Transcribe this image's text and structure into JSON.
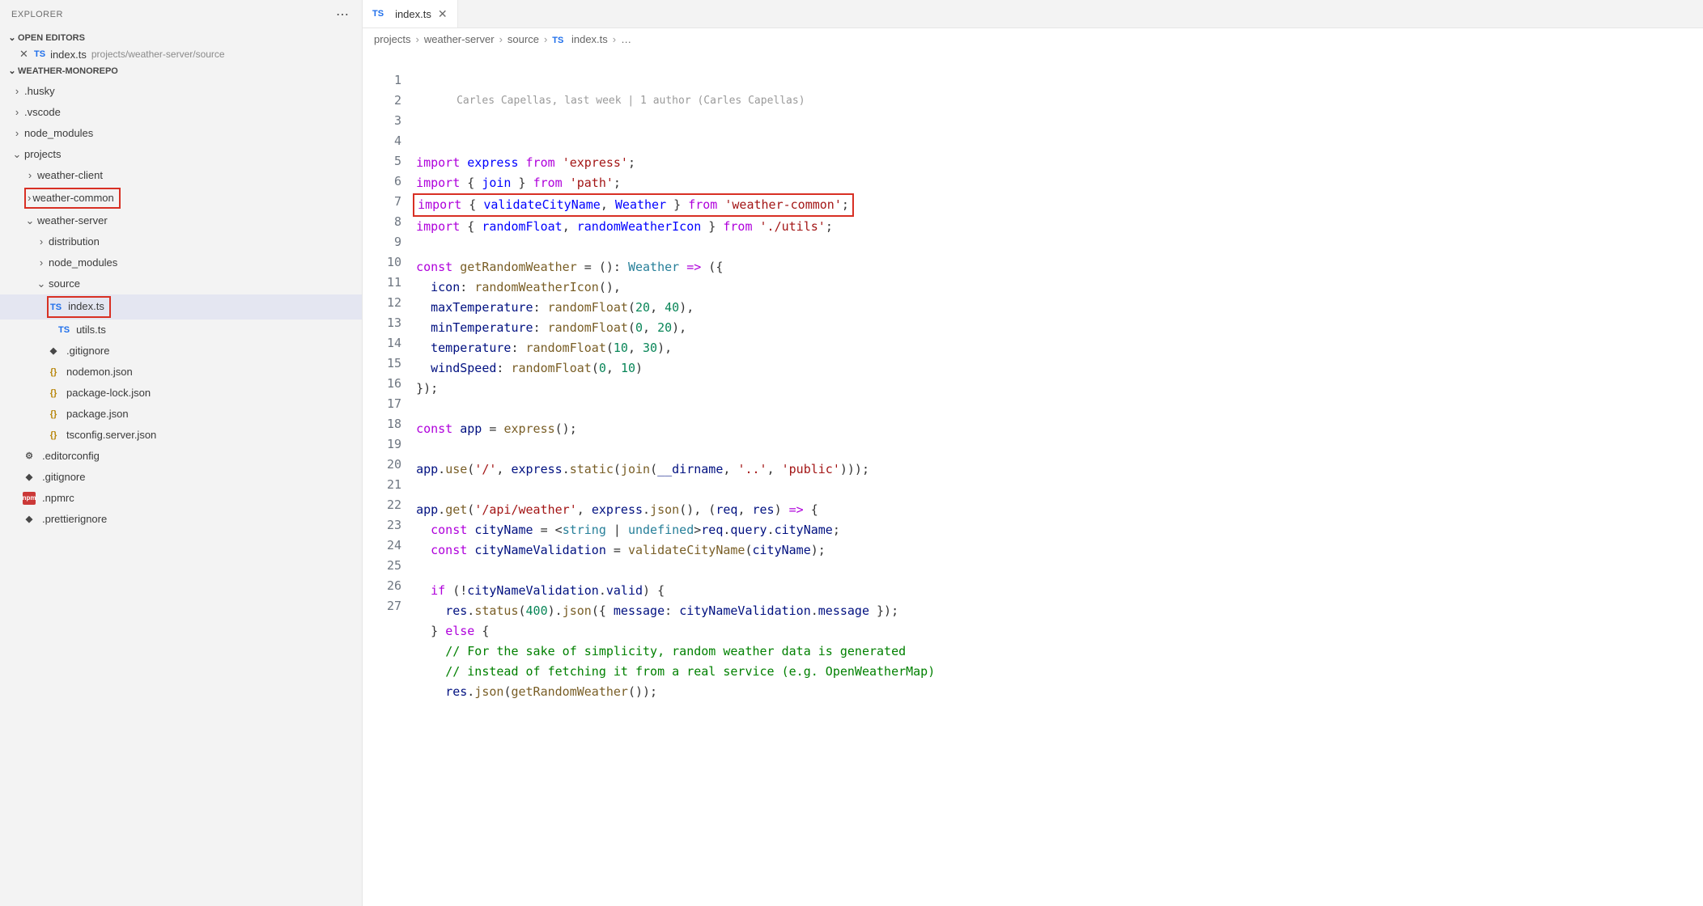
{
  "sidebar": {
    "title": "EXPLORER",
    "openEditors": {
      "label": "OPEN EDITORS",
      "items": [
        {
          "type": "TS",
          "name": "index.ts",
          "path": "projects/weather-server/source"
        }
      ]
    },
    "workspace": {
      "label": "WEATHER-MONOREPO",
      "tree": [
        {
          "label": ".husky",
          "kind": "folder",
          "expanded": false,
          "depth": 0
        },
        {
          "label": ".vscode",
          "kind": "folder",
          "expanded": false,
          "depth": 0
        },
        {
          "label": "node_modules",
          "kind": "folder",
          "expanded": false,
          "depth": 0
        },
        {
          "label": "projects",
          "kind": "folder",
          "expanded": true,
          "depth": 0
        },
        {
          "label": "weather-client",
          "kind": "folder",
          "expanded": false,
          "depth": 1
        },
        {
          "label": "weather-common",
          "kind": "folder",
          "expanded": false,
          "depth": 1,
          "highlight": true
        },
        {
          "label": "weather-server",
          "kind": "folder",
          "expanded": true,
          "depth": 1
        },
        {
          "label": "distribution",
          "kind": "folder",
          "expanded": false,
          "depth": 2
        },
        {
          "label": "node_modules",
          "kind": "folder",
          "expanded": false,
          "depth": 2
        },
        {
          "label": "source",
          "kind": "folder",
          "expanded": true,
          "depth": 2
        },
        {
          "label": "index.ts",
          "kind": "file",
          "icon": "ts",
          "depth": 3,
          "active": true,
          "highlight": true
        },
        {
          "label": "utils.ts",
          "kind": "file",
          "icon": "ts",
          "depth": 3
        },
        {
          "label": ".gitignore",
          "kind": "file",
          "icon": "diamond",
          "depth": 2
        },
        {
          "label": "nodemon.json",
          "kind": "file",
          "icon": "json",
          "depth": 2
        },
        {
          "label": "package-lock.json",
          "kind": "file",
          "icon": "json",
          "depth": 2
        },
        {
          "label": "package.json",
          "kind": "file",
          "icon": "json",
          "depth": 2
        },
        {
          "label": "tsconfig.server.json",
          "kind": "file",
          "icon": "json",
          "depth": 2
        },
        {
          "label": ".editorconfig",
          "kind": "file",
          "icon": "gear",
          "depth": 0
        },
        {
          "label": ".gitignore",
          "kind": "file",
          "icon": "diamond",
          "depth": 0
        },
        {
          "label": ".npmrc",
          "kind": "file",
          "icon": "npm",
          "depth": 0
        },
        {
          "label": ".prettierignore",
          "kind": "file",
          "icon": "diamond",
          "depth": 0
        }
      ]
    }
  },
  "editor": {
    "tab": {
      "type": "TS",
      "name": "index.ts"
    },
    "breadcrumbs": [
      "projects",
      "weather-server",
      "source",
      "index.ts",
      "…"
    ],
    "blame": "Carles Capellas, last week | 1 author (Carles Capellas)",
    "lines": [
      {
        "n": 1,
        "html": "<span class='tok-kw'>import</span> <span class='tok-var'>express</span> <span class='tok-kw'>from</span> <span class='tok-str'>'express'</span>;"
      },
      {
        "n": 2,
        "html": "<span class='tok-kw'>import</span> { <span class='tok-var'>join</span> } <span class='tok-kw'>from</span> <span class='tok-str'>'path'</span>;"
      },
      {
        "n": 3,
        "html": "<span class='tok-kw'>import</span> { <span class='tok-var'>validateCityName</span>, <span class='tok-var'>Weather</span> } <span class='tok-kw'>from</span> <span class='tok-str'>'weather-common'</span>;",
        "highlight": true
      },
      {
        "n": 4,
        "html": "<span class='tok-kw'>import</span> { <span class='tok-var'>randomFloat</span>, <span class='tok-var'>randomWeatherIcon</span> } <span class='tok-kw'>from</span> <span class='tok-str'>'./utils'</span>;"
      },
      {
        "n": 5,
        "html": ""
      },
      {
        "n": 6,
        "html": "<span class='tok-kw'>const</span> <span class='tok-call'>getRandomWeather</span> = (): <span class='tok-typeref'>Weather</span> <span class='tok-kw'>=&gt;</span> ({"
      },
      {
        "n": 7,
        "html": "  <span class='tok-prop'>icon</span>: <span class='tok-call'>randomWeatherIcon</span>(),"
      },
      {
        "n": 8,
        "html": "  <span class='tok-prop'>maxTemperature</span>: <span class='tok-call'>randomFloat</span>(<span class='tok-num'>20</span>, <span class='tok-num'>40</span>),"
      },
      {
        "n": 9,
        "html": "  <span class='tok-prop'>minTemperature</span>: <span class='tok-call'>randomFloat</span>(<span class='tok-num'>0</span>, <span class='tok-num'>20</span>),"
      },
      {
        "n": 10,
        "html": "  <span class='tok-prop'>temperature</span>: <span class='tok-call'>randomFloat</span>(<span class='tok-num'>10</span>, <span class='tok-num'>30</span>),"
      },
      {
        "n": 11,
        "html": "  <span class='tok-prop'>windSpeed</span>: <span class='tok-call'>randomFloat</span>(<span class='tok-num'>0</span>, <span class='tok-num'>10</span>)"
      },
      {
        "n": 12,
        "html": "});"
      },
      {
        "n": 13,
        "html": ""
      },
      {
        "n": 14,
        "html": "<span class='tok-kw'>const</span> <span class='tok-prop'>app</span> = <span class='tok-call'>express</span>();"
      },
      {
        "n": 15,
        "html": ""
      },
      {
        "n": 16,
        "html": "<span class='tok-prop'>app</span>.<span class='tok-call'>use</span>(<span class='tok-str'>'/'</span>, <span class='tok-prop'>express</span>.<span class='tok-call'>static</span>(<span class='tok-call'>join</span>(<span class='tok-prop'>__dirname</span>, <span class='tok-str'>'..'</span>, <span class='tok-str'>'public'</span>)));"
      },
      {
        "n": 17,
        "html": ""
      },
      {
        "n": 18,
        "html": "<span class='tok-prop'>app</span>.<span class='tok-call'>get</span>(<span class='tok-str'>'/api/weather'</span>, <span class='tok-prop'>express</span>.<span class='tok-call'>json</span>(), (<span class='tok-param'>req</span>, <span class='tok-param'>res</span>) <span class='tok-kw'>=&gt;</span> {"
      },
      {
        "n": 19,
        "html": "  <span class='tok-kw'>const</span> <span class='tok-prop'>cityName</span> = &lt;<span class='tok-typeref'>string</span> | <span class='tok-typeref'>undefined</span>&gt;<span class='tok-prop'>req</span>.<span class='tok-prop'>query</span>.<span class='tok-prop'>cityName</span>;"
      },
      {
        "n": 20,
        "html": "  <span class='tok-kw'>const</span> <span class='tok-prop'>cityNameValidation</span> = <span class='tok-call'>validateCityName</span>(<span class='tok-prop'>cityName</span>);"
      },
      {
        "n": 21,
        "html": ""
      },
      {
        "n": 22,
        "html": "  <span class='tok-kw'>if</span> (!<span class='tok-prop'>cityNameValidation</span>.<span class='tok-prop'>valid</span>) {"
      },
      {
        "n": 23,
        "html": "    <span class='tok-prop'>res</span>.<span class='tok-call'>status</span>(<span class='tok-num'>400</span>).<span class='tok-call'>json</span>({ <span class='tok-prop'>message</span>: <span class='tok-prop'>cityNameValidation</span>.<span class='tok-prop'>message</span> });"
      },
      {
        "n": 24,
        "html": "  } <span class='tok-kw'>else</span> {"
      },
      {
        "n": 25,
        "html": "    <span class='tok-comment'>// For the sake of simplicity, random weather data is generated</span>"
      },
      {
        "n": 26,
        "html": "    <span class='tok-comment'>// instead of fetching it from a real service (e.g. OpenWeatherMap)</span>"
      },
      {
        "n": 27,
        "html": "    <span class='tok-prop'>res</span>.<span class='tok-call'>json</span>(<span class='tok-call'>getRandomWeather</span>());"
      }
    ]
  }
}
